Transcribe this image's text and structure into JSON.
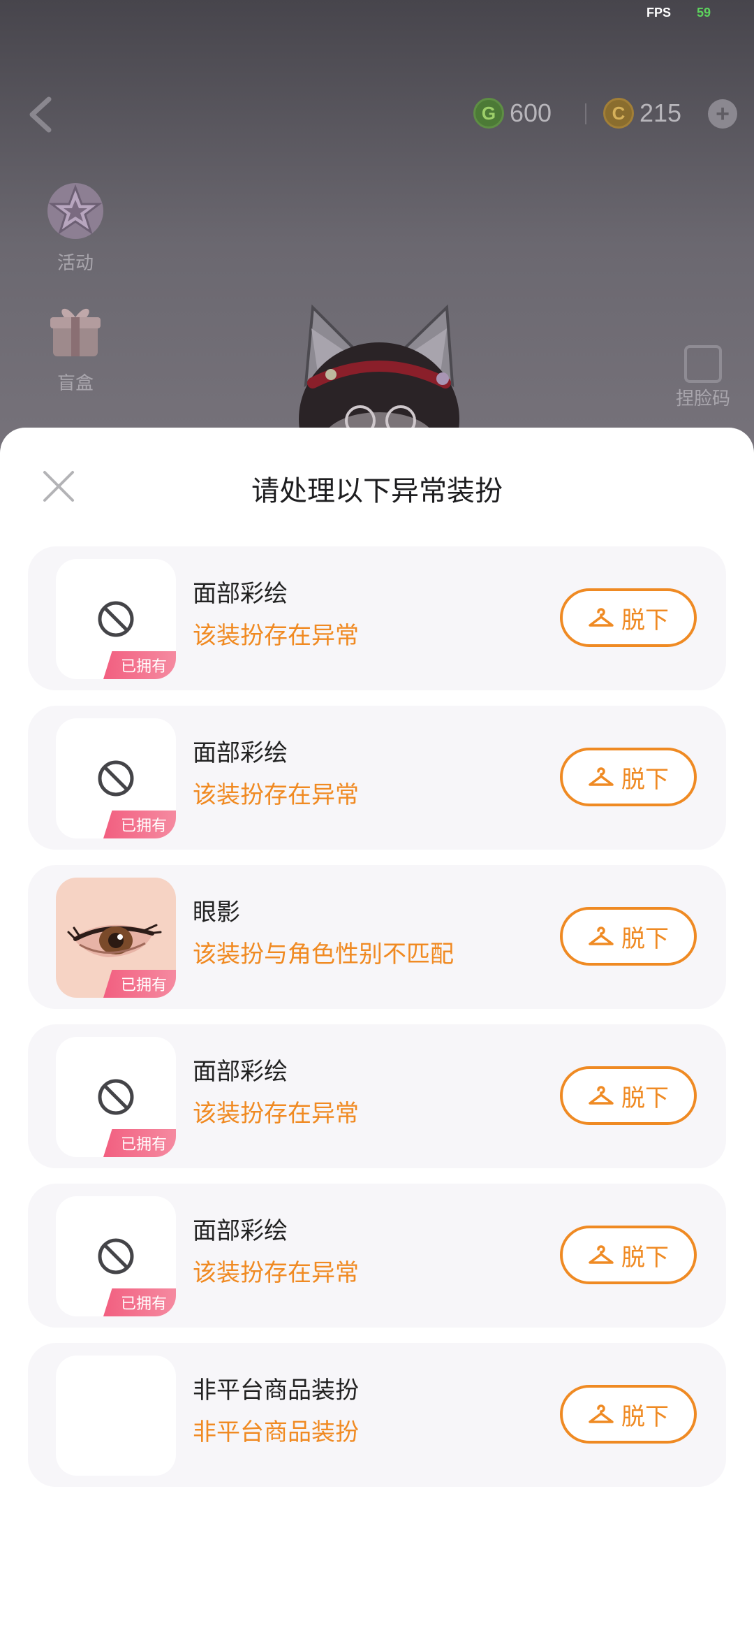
{
  "status": {
    "fps_label": "FPS",
    "fps_value": "59"
  },
  "header": {
    "currencies": [
      {
        "icon": "g-coin-icon",
        "symbol": "G",
        "value": "600"
      },
      {
        "icon": "gold-coin-icon",
        "symbol": "C",
        "value": "215"
      }
    ],
    "plus": "+"
  },
  "sidebar": {
    "items": [
      {
        "label": "活动",
        "icon": "star-icon"
      },
      {
        "label": "盲盒",
        "icon": "gift-box-icon"
      }
    ]
  },
  "pinch_code": {
    "label": "捏脸码",
    "icon": "edit-icon"
  },
  "sheet": {
    "title": "请处理以下异常装扮",
    "items": [
      {
        "name": "面部彩绘",
        "desc": "该装扮存在异常",
        "thumb": "ban-icon",
        "badge": "已拥有",
        "button": "脱下"
      },
      {
        "name": "面部彩绘",
        "desc": "该装扮存在异常",
        "thumb": "ban-icon",
        "badge": "已拥有",
        "button": "脱下"
      },
      {
        "name": "眼影",
        "desc": "该装扮与角色性别不匹配",
        "thumb": "eye-shadow-image",
        "badge": "已拥有",
        "button": "脱下"
      },
      {
        "name": "面部彩绘",
        "desc": "该装扮存在异常",
        "thumb": "ban-icon",
        "badge": "已拥有",
        "button": "脱下"
      },
      {
        "name": "面部彩绘",
        "desc": "该装扮存在异常",
        "thumb": "ban-icon",
        "badge": "已拥有",
        "button": "脱下"
      },
      {
        "name": "非平台商品装扮",
        "desc": "非平台商品装扮",
        "thumb": "blank",
        "badge": "",
        "button": "脱下"
      }
    ]
  },
  "colors": {
    "accent": "#ef8a23",
    "badge": "#f25f80",
    "card": "#f7f6f9",
    "fps_value": "#5dd35d"
  }
}
